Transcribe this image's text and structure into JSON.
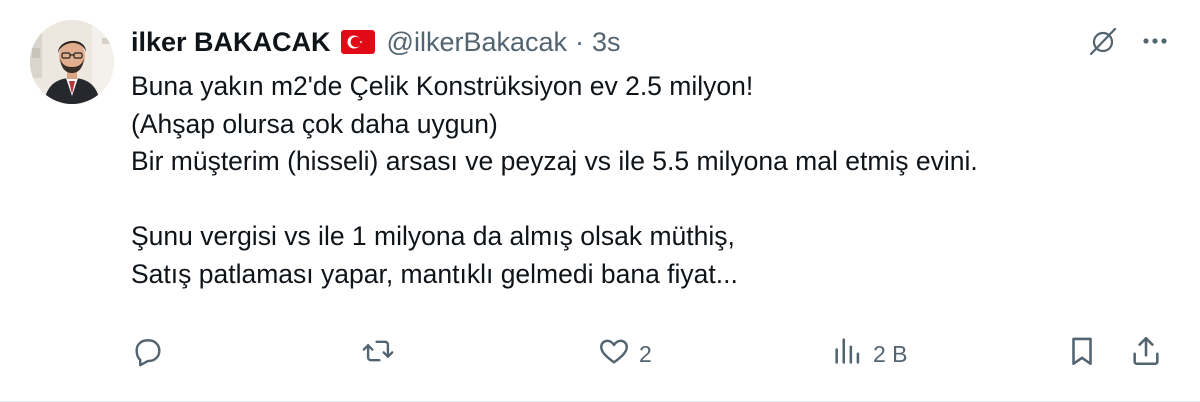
{
  "author": {
    "name": "ilker BAKACAK",
    "flag_icon": "turkey-flag-icon",
    "handle": "@ilkerBakacak",
    "separator": "·",
    "time": "3s"
  },
  "tweet": {
    "lines": [
      "Buna yakın m2'de Çelik Konstrüksiyon ev 2.5 milyon!",
      "(Ahşap olursa çok daha uygun)",
      "Bir müşterim (hisseli) arsası ve peyzaj vs ile 5.5 milyona mal etmiş evini.",
      "",
      "Şunu vergisi vs ile 1 milyona da almış olsak müthiş,",
      "Satış patlaması yapar, mantıklı gelmedi bana fiyat..."
    ]
  },
  "actions": {
    "reply_count": "",
    "retweet_count": "",
    "like_count": "2",
    "views_count": "2 B"
  },
  "colors": {
    "text": "#0f1419",
    "muted": "#536471",
    "flag_red": "#e30a17"
  },
  "icons": {
    "top": [
      "grok-icon",
      "more-icon"
    ],
    "actions": [
      "reply-icon",
      "retweet-icon",
      "like-icon",
      "views-icon",
      "bookmark-icon",
      "share-icon"
    ]
  }
}
